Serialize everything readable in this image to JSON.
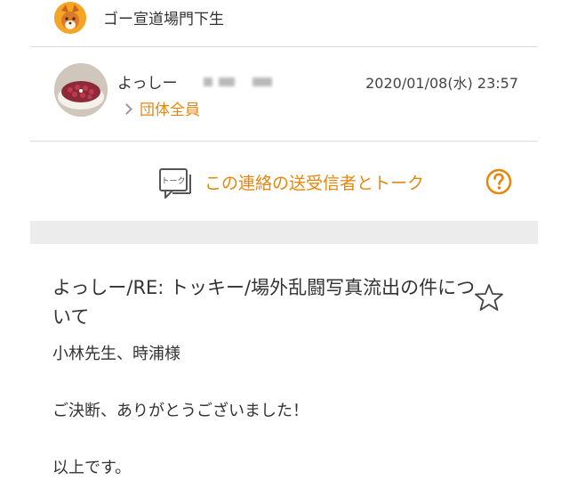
{
  "group": {
    "name": "ゴー宣道場門下生",
    "avatar_icon": "shiba-dog-icon"
  },
  "sender": {
    "name": "よっしー",
    "avatar_icon": "cake-photo-avatar",
    "date": "2020/01/08(水) 23:57",
    "recipients": "団体全員"
  },
  "talk": {
    "icon_label": "トーク",
    "label": "この連絡の送受信者とトーク",
    "help_icon": "question-circle-icon"
  },
  "message": {
    "subject": "よっしー/RE: トッキー/場外乱闘写真流出の件について",
    "star_icon": "star-outline-icon",
    "lines": [
      "小林先生、時浦様",
      "ご決断、ありがとうございました！",
      "以上です。"
    ]
  },
  "colors": {
    "accent": "#e8860c",
    "divider": "#ececec"
  }
}
